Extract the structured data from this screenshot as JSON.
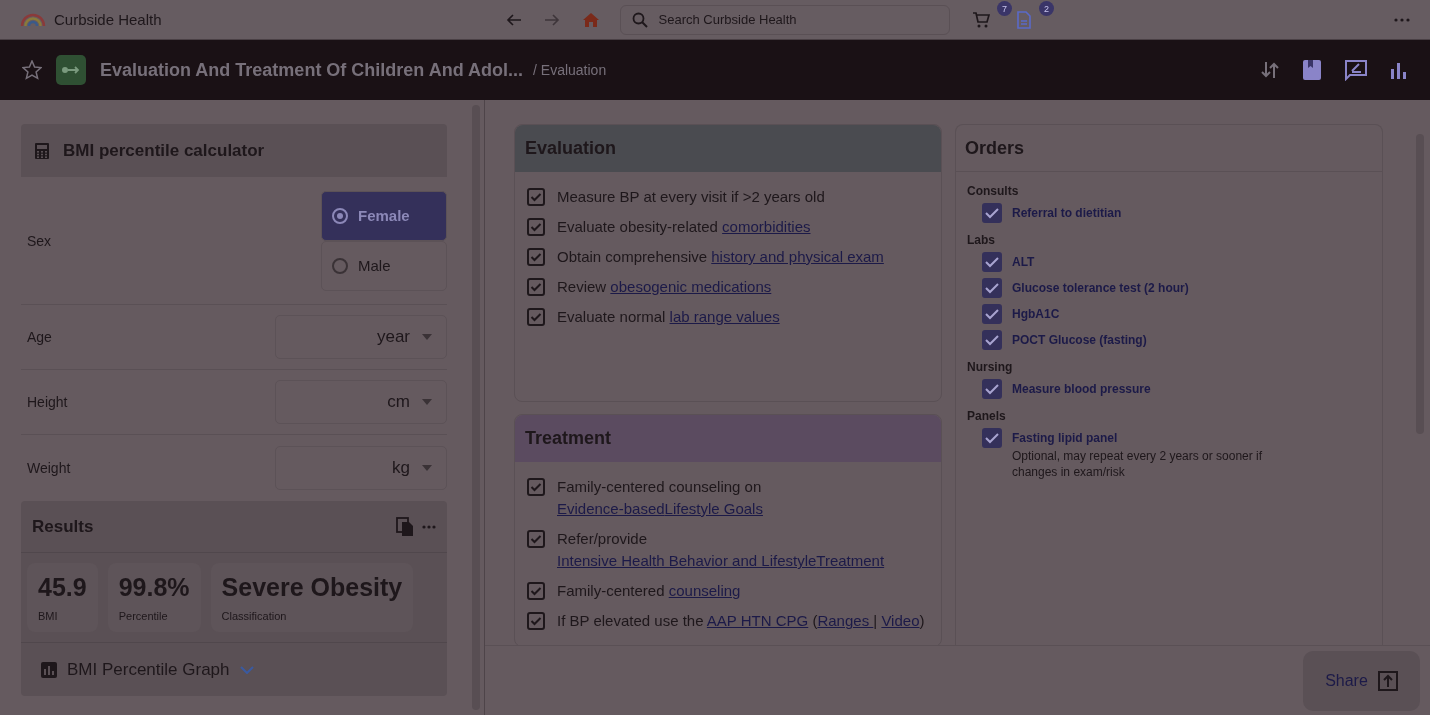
{
  "topbar": {
    "app_name": "Curbside Health",
    "search": {
      "placeholder": "Search Curbside Health"
    },
    "cart_badge": "7",
    "doc_badge": "2"
  },
  "header": {
    "title": "Evaluation And Treatment Of Children And Adol...",
    "breadcrumb": "/ Evaluation",
    "starred": false
  },
  "calculator": {
    "title": "BMI percentile calculator",
    "sex": {
      "label": "Sex",
      "options": [
        {
          "label": "Female",
          "selected": true
        },
        {
          "label": "Male",
          "selected": false
        }
      ]
    },
    "fields": [
      {
        "label": "Age",
        "unit": "year"
      },
      {
        "label": "Height",
        "unit": "cm"
      },
      {
        "label": "Weight",
        "unit": "kg"
      }
    ],
    "results": {
      "title": "Results",
      "stats": [
        {
          "value": "45.9",
          "label": "BMI"
        },
        {
          "value": "99.8%",
          "label": "Percentile"
        },
        {
          "value": "Severe Obesity",
          "label": "Classification"
        }
      ]
    },
    "graph": {
      "title": "BMI Percentile Graph",
      "expanded": false
    }
  },
  "sections": [
    {
      "title": "Evaluation",
      "kind": "evaluation",
      "items": [
        {
          "checked": true,
          "parts": [
            {
              "text": "Measure BP at every visit if >2 years old",
              "kind": "text"
            }
          ]
        },
        {
          "checked": true,
          "parts": [
            {
              "text": "Evaluate obesity-related ",
              "kind": "text"
            },
            {
              "text": "comorbidities",
              "kind": "link"
            }
          ]
        },
        {
          "checked": true,
          "parts": [
            {
              "text": "Obtain comprehensive ",
              "kind": "text"
            },
            {
              "text": "history and physical exam",
              "kind": "link"
            }
          ]
        },
        {
          "checked": true,
          "parts": [
            {
              "text": "Review ",
              "kind": "text"
            },
            {
              "text": "obesogenic medications",
              "kind": "link"
            }
          ]
        },
        {
          "checked": true,
          "parts": [
            {
              "text": "Evaluate normal ",
              "kind": "text"
            },
            {
              "text": "lab range values",
              "kind": "link"
            }
          ]
        }
      ]
    },
    {
      "title": "Treatment",
      "kind": "treatment",
      "items": [
        {
          "checked": true,
          "parts": [
            {
              "text": "Family-centered counseling on ",
              "kind": "text"
            },
            {
              "text": "Evidence-based",
              "kind": "link"
            },
            {
              "text": "Lifestyle Goals ",
              "kind": "link"
            }
          ]
        },
        {
          "checked": true,
          "parts": [
            {
              "text": "Refer/provide ",
              "kind": "text"
            },
            {
              "text": "Intensive Health Behavior and Lifestyle",
              "kind": "link"
            },
            {
              "text": "Treatment",
              "kind": "link"
            }
          ]
        },
        {
          "checked": true,
          "parts": [
            {
              "text": "Family-centered ",
              "kind": "text"
            },
            {
              "text": "counseling",
              "kind": "link"
            }
          ]
        },
        {
          "checked": true,
          "parts": [
            {
              "text": "If BP elevated use the ",
              "kind": "text"
            },
            {
              "text": "AAP HTN CPG",
              "kind": "link"
            },
            {
              "text": " (",
              "kind": "text"
            },
            {
              "text": "Ranges ",
              "kind": "link"
            },
            {
              "text": "| ",
              "kind": "text"
            },
            {
              "text": "Video",
              "kind": "link"
            },
            {
              "text": ")",
              "kind": "text"
            }
          ]
        }
      ]
    }
  ],
  "orders": {
    "title": "Orders",
    "groups": [
      {
        "name": "Consults",
        "items": [
          {
            "label": "Referral to dietitian",
            "checked": true
          }
        ]
      },
      {
        "name": "Labs",
        "items": [
          {
            "label": "ALT",
            "checked": true
          },
          {
            "label": "Glucose tolerance test (2 hour)",
            "checked": true
          },
          {
            "label": "HgbA1C",
            "checked": true
          },
          {
            "label": "POCT Glucose (fasting)",
            "checked": true
          }
        ]
      },
      {
        "name": "Nursing",
        "items": [
          {
            "label": "Measure blood pressure",
            "checked": true
          }
        ]
      },
      {
        "name": "Panels",
        "items": [
          {
            "label": "Fasting lipid panel",
            "checked": true,
            "note": "Optional, may repeat every 2 years or sooner if changes in exam/risk"
          }
        ]
      }
    ]
  },
  "share_button": "Share"
}
